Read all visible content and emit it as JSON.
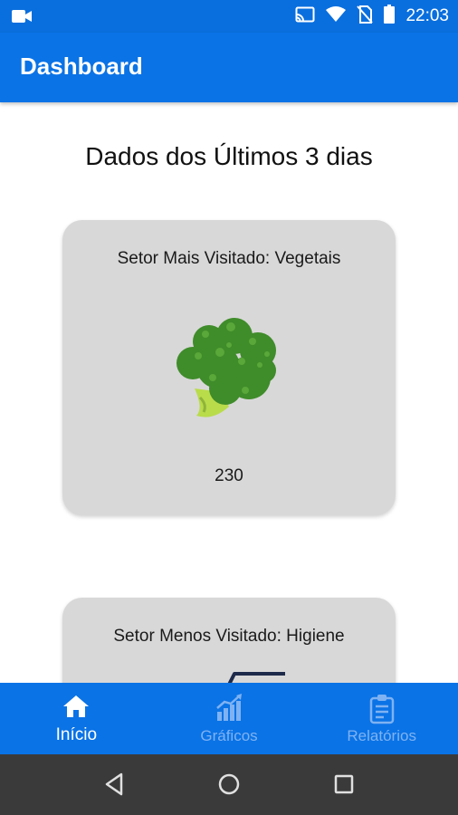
{
  "status_bar": {
    "time": "22:03",
    "icons": [
      "video-camera-icon",
      "cast-icon",
      "wifi-icon",
      "no-sim-icon",
      "battery-icon"
    ]
  },
  "app_bar": {
    "title": "Dashboard"
  },
  "main": {
    "section_title": "Dados dos Últimos 3 dias",
    "cards": [
      {
        "label": "Setor Mais Visitado: Vegetais",
        "icon": "broccoli-icon",
        "value": "230"
      },
      {
        "label": "Setor Menos Visitado: Higiene",
        "icon": "hygiene-icon"
      }
    ]
  },
  "bottom_nav": {
    "items": [
      {
        "label": "Início",
        "icon": "home-icon",
        "active": true
      },
      {
        "label": "Gráficos",
        "icon": "chart-icon",
        "active": false
      },
      {
        "label": "Relatórios",
        "icon": "clipboard-icon",
        "active": false
      }
    ]
  },
  "system_nav": {
    "buttons": [
      "back-icon",
      "home-circle-icon",
      "recents-icon"
    ]
  },
  "colors": {
    "primary": "#0a73e6",
    "status_bar": "#0a6fde",
    "card_bg": "#d8d8d8",
    "nav_inactive": "#7fb2f2",
    "system_nav_bg": "#3a3a3a"
  }
}
